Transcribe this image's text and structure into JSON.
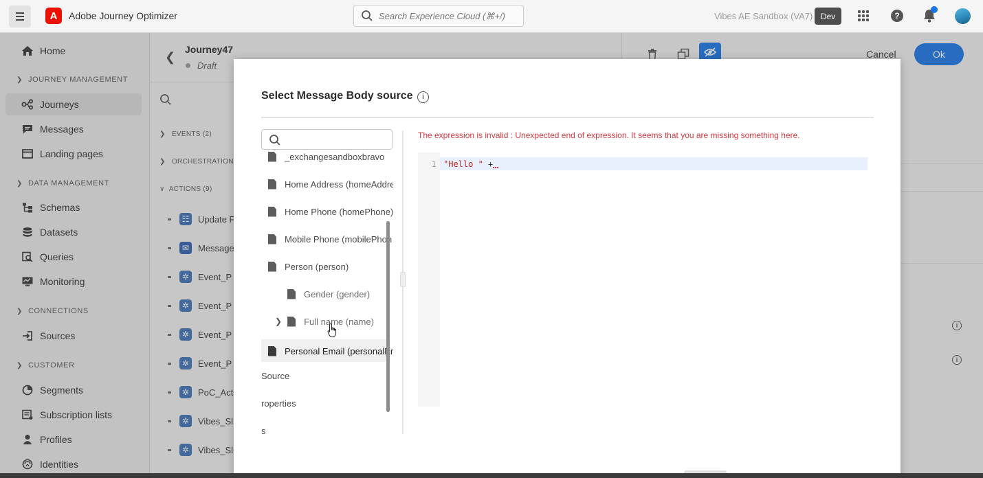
{
  "app": {
    "title": "Adobe Journey Optimizer",
    "logo_letter": "A",
    "search_placeholder": "Search Experience Cloud (⌘+/)",
    "sandbox": "Vibes AE Sandbox (VA7)",
    "environment": "Dev",
    "brand_color": "#eb1000",
    "accent_color": "#1473e6"
  },
  "sidebar": {
    "home": "Home",
    "sections": [
      {
        "label": "JOURNEY MANAGEMENT",
        "items": [
          "Journeys",
          "Messages",
          "Landing pages"
        ]
      },
      {
        "label": "DATA MANAGEMENT",
        "items": [
          "Schemas",
          "Datasets",
          "Queries",
          "Monitoring"
        ]
      },
      {
        "label": "CONNECTIONS",
        "items": [
          "Sources"
        ]
      },
      {
        "label": "CUSTOMER",
        "items": [
          "Segments",
          "Subscription lists",
          "Profiles",
          "Identities"
        ]
      }
    ],
    "active_item": "Journeys"
  },
  "journey": {
    "name": "Journey47",
    "status": "Draft"
  },
  "palette": {
    "categories": [
      "EVENTS (2)",
      "ORCHESTRATION (",
      "ACTIONS (9)"
    ],
    "actions": [
      "Update F",
      "Message",
      "Event_P",
      "Event_P",
      "Event_P",
      "Event_P",
      "PoC_Act",
      "Vibes_Sl",
      "Vibes_Sl"
    ]
  },
  "right_panel": {
    "cancel_label": "Cancel",
    "ok_label": "Ok",
    "info_glyph": "i"
  },
  "modal": {
    "title": "Select Message Body source",
    "info_glyph": "i",
    "error_message": "The expression is invalid : Unexpected end of expression. It seems that you are missing something here.",
    "tree_search_placeholder": "",
    "tree_items": [
      {
        "label": "_exchangesandboxbravo",
        "level": 0
      },
      {
        "label": "Home Address (homeAddre",
        "level": 0
      },
      {
        "label": "Home Phone (homePhone)",
        "level": 0
      },
      {
        "label": "Mobile Phone (mobilePhon",
        "level": 0
      },
      {
        "label": "Person (person)",
        "level": 0
      },
      {
        "label": "Gender (gender)",
        "level": 1
      },
      {
        "label": "Full name (name)",
        "level": 1,
        "expandable": true
      },
      {
        "label": "Personal Email (personalEm",
        "level": 0,
        "selected": true
      }
    ],
    "tree_truncated": [
      "Source",
      "roperties",
      "s"
    ],
    "editor": {
      "line_number": "1",
      "code_string": "\"Hello \"",
      "code_operator": " +"
    }
  }
}
